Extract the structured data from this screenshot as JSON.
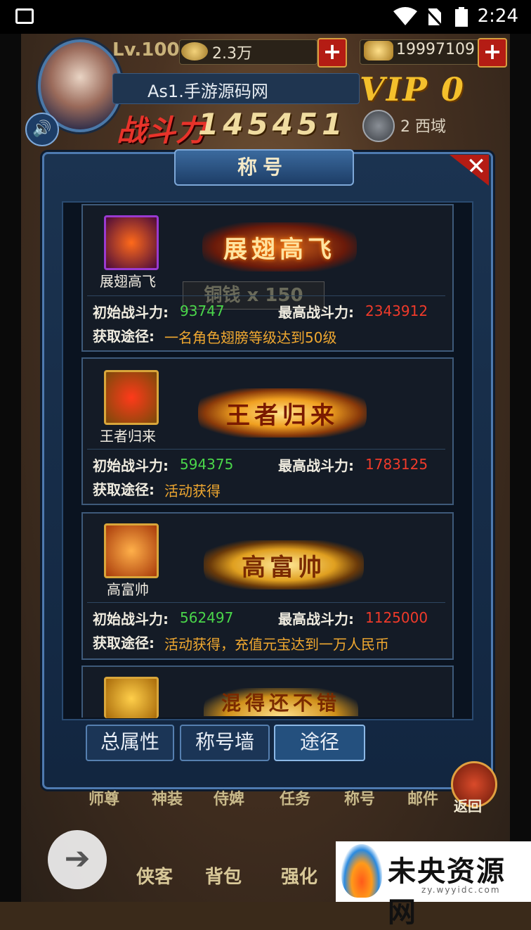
{
  "status_bar": {
    "time": "2:24"
  },
  "hud": {
    "level": "Lv.100",
    "copper": "2.3万",
    "gold": "19997109",
    "plus": "+",
    "player_name": "As1.手游源码网",
    "vip": "VIP 0",
    "power_label": "战斗力",
    "power": "145451",
    "server": "2 西域"
  },
  "modal": {
    "title": "称号",
    "close": "✕",
    "cards": [
      {
        "name": "展翅高飞",
        "banner": "展翅高飞",
        "overlay": "铜钱 x 150",
        "initial_label": "初始战斗力:",
        "initial": "93747",
        "max_label": "最高战斗力:",
        "max": "2343912",
        "source_label": "获取途径:",
        "source": "一名角色翅膀等级达到50级"
      },
      {
        "name": "王者归来",
        "banner": "王者归来",
        "initial_label": "初始战斗力:",
        "initial": "594375",
        "max_label": "最高战斗力:",
        "max": "1783125",
        "source_label": "获取途径:",
        "source": "活动获得"
      },
      {
        "name": "高富帅",
        "banner": "高富帅",
        "initial_label": "初始战斗力:",
        "initial": "562497",
        "max_label": "最高战斗力:",
        "max": "1125000",
        "source_label": "获取途径:",
        "source": "活动获得，充值元宝达到一万人民币"
      },
      {
        "banner": "混得还不错"
      }
    ],
    "tabs": [
      "总属性",
      "称号墙",
      "途径"
    ]
  },
  "bottom": {
    "menu": [
      "师尊",
      "神装",
      "侍婢",
      "任务",
      "称号",
      "邮件"
    ],
    "main": [
      "侠客",
      "背包",
      "强化"
    ],
    "return_label": "返回"
  },
  "watermark": {
    "text": "未央资源网",
    "url": "zy.wyyidc.com"
  },
  "colors": {
    "accent_red": "#b41c14",
    "stat_green": "#4ad64a",
    "stat_red": "#f03a2a",
    "path_orange": "#f0a830"
  }
}
